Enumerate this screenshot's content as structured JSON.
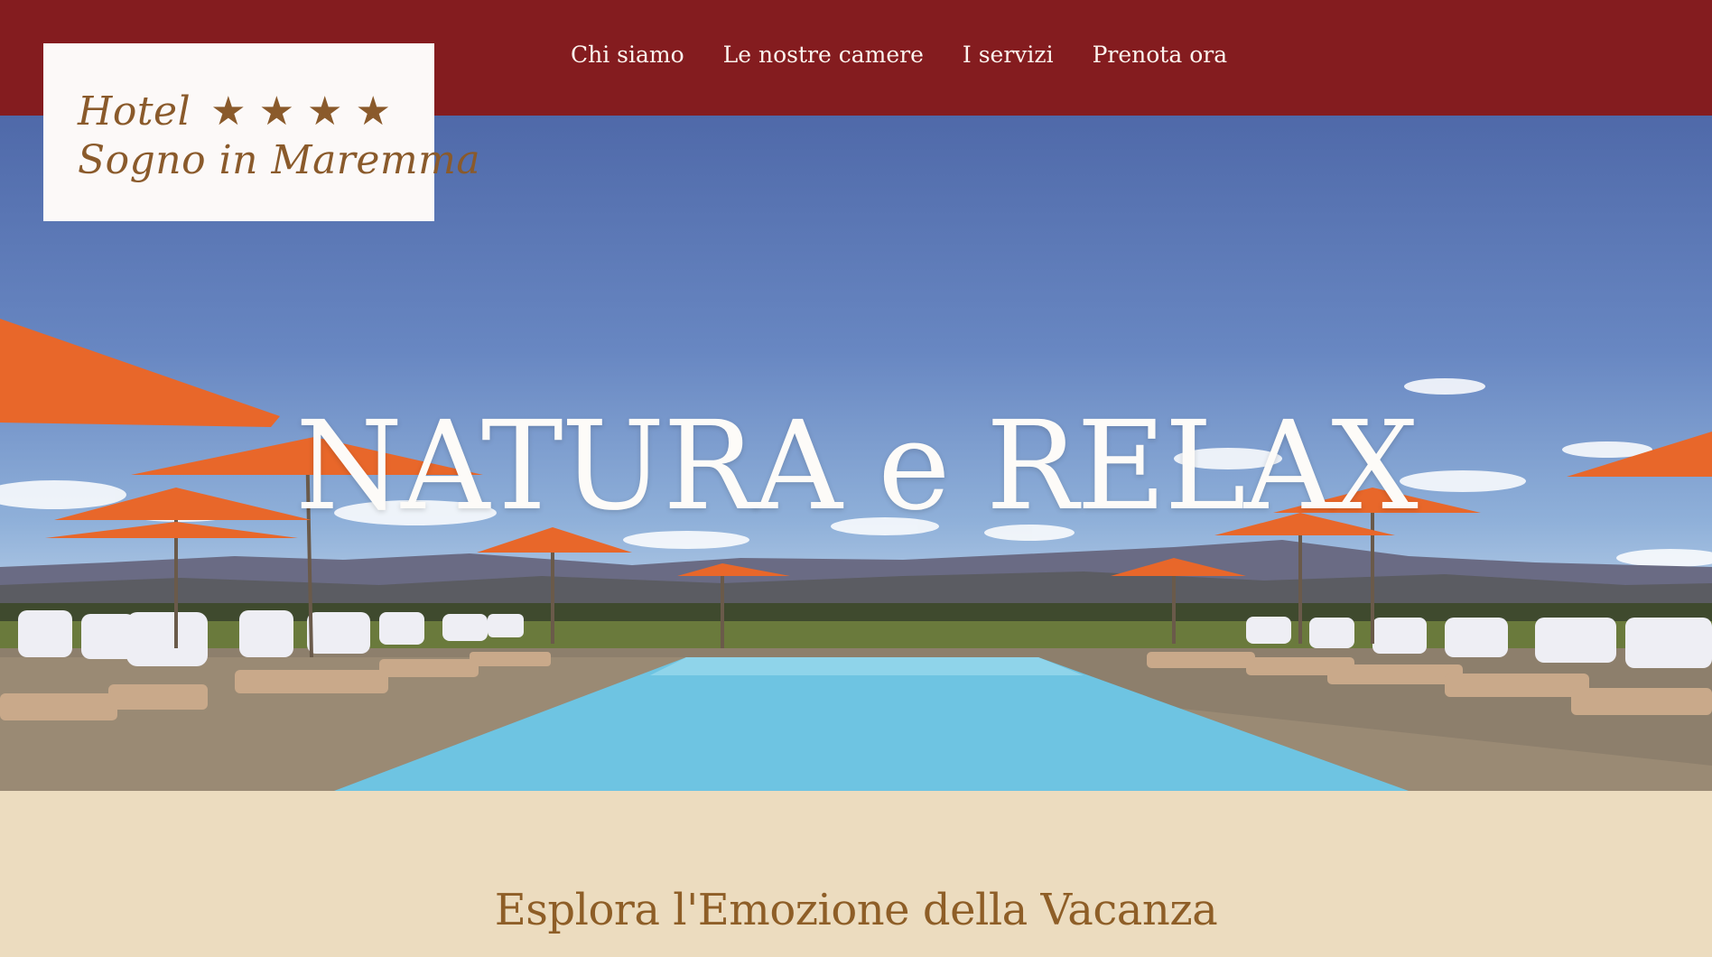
{
  "logo": {
    "line1": "Hotel",
    "stars": "★★★★",
    "line2": "Sogno in Maremma"
  },
  "nav": {
    "items": [
      {
        "label": "Chi siamo"
      },
      {
        "label": "Le nostre camere"
      },
      {
        "label": "I servizi"
      },
      {
        "label": "Prenota ora"
      }
    ]
  },
  "hero": {
    "title": "NATURA e RELAX"
  },
  "section": {
    "title": "Esplora l'Emozione della Vacanza"
  },
  "colors": {
    "header_bg": "#841c1f",
    "logo_text": "#8a5a2b",
    "section_bg": "#ecdcbf",
    "section_title": "#8e5e27",
    "umbrella": "#e8672a",
    "pool": "#6ec4e2"
  }
}
